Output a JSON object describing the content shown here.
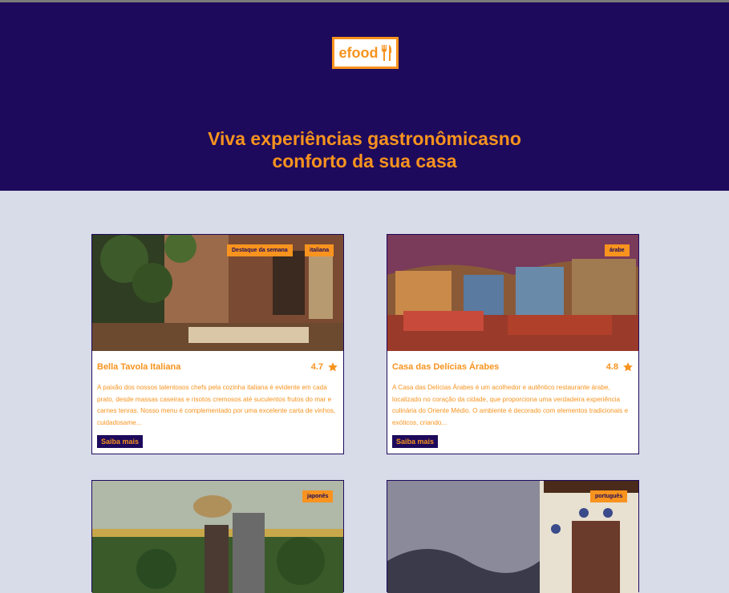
{
  "header": {
    "logo_text": "efood",
    "headline_line1": "Viva experiências gastronômicasno",
    "headline_line2": "conforto da sua casa"
  },
  "restaurants": [
    {
      "name": "Bella Tavola Italiana",
      "rating": "4.7",
      "tags": [
        "Destaque da semana",
        "italiana"
      ],
      "description": "A paixão dos nossos talentosos chefs pela cozinha italiana é evidente em cada prato, desde massas caseiras e risotos cremosos até suculentos frutos do mar e carnes tenras. Nosso menu é complementado por uma excelente carta de vinhos, cuidadosame...",
      "button": "Saiba mais"
    },
    {
      "name": "Casa das Delícias Árabes",
      "rating": "4.8",
      "tags": [
        "árabe"
      ],
      "description": "A Casa das Delícias Árabes é um acolhedor e autêntico restaurante árabe, localizado no coração da cidade, que proporciona uma verdadeira experiência culinária do Oriente Médio. O ambiente é decorado com elementos tradicionais e exóticos, criando...",
      "button": "Saiba mais"
    },
    {
      "tags": [
        "japonês"
      ]
    },
    {
      "tags": [
        "português"
      ]
    }
  ],
  "colors": {
    "primary": "#1e0a5c",
    "accent": "#f7931e",
    "background": "#d8dbe8"
  },
  "icons": {
    "logo": "fork-knife-icon",
    "rating": "star-icon"
  }
}
